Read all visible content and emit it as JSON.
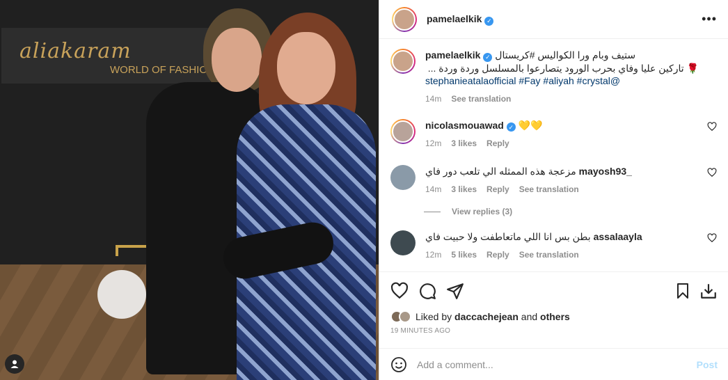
{
  "photo": {
    "sign_script": "aliakaram",
    "sign_sub": "WORLD OF FASHION"
  },
  "post": {
    "author": "pamelaelkik",
    "caption_line1": "ستيف وبام ورا الكواليس #كريستال",
    "caption_line2": "🌹 تاركين عليا وفاي بحرب الورود يتصارعوا بالمسلسل وردة وردة ...",
    "caption_line3": "stephanieatalaofficial #Fay #aliyah #crystal@",
    "caption_time": "14m",
    "see_translation": "See translation"
  },
  "comments": [
    {
      "user": "nicolasmouawad",
      "verified": true,
      "text": "💛💛",
      "time": "12m",
      "likes": "3 likes",
      "reply": "Reply",
      "translation": ""
    },
    {
      "user": "_mayosh93",
      "verified": false,
      "text": "مزعجة هذه الممثله الي تلعب دور فاي",
      "time": "14m",
      "likes": "3 likes",
      "reply": "Reply",
      "translation": "See translation"
    },
    {
      "user": "assalaayla",
      "verified": false,
      "text": "بطن بس انا اللي ماتعاطفت ولا حبيت فاي",
      "time": "12m",
      "likes": "5 likes",
      "reply": "Reply",
      "translation": "See translation"
    }
  ],
  "view_replies": "View replies (3)",
  "likes": {
    "prefix": "Liked by",
    "user": "daccachejean",
    "and": "and",
    "others": "others"
  },
  "time_ago": "19 MINUTES AGO",
  "add_comment": {
    "placeholder": "Add a comment...",
    "post_label": "Post"
  },
  "colors": {
    "link": "#00376b",
    "verified": "#3897f0",
    "post_disabled": "#b2dffc"
  }
}
